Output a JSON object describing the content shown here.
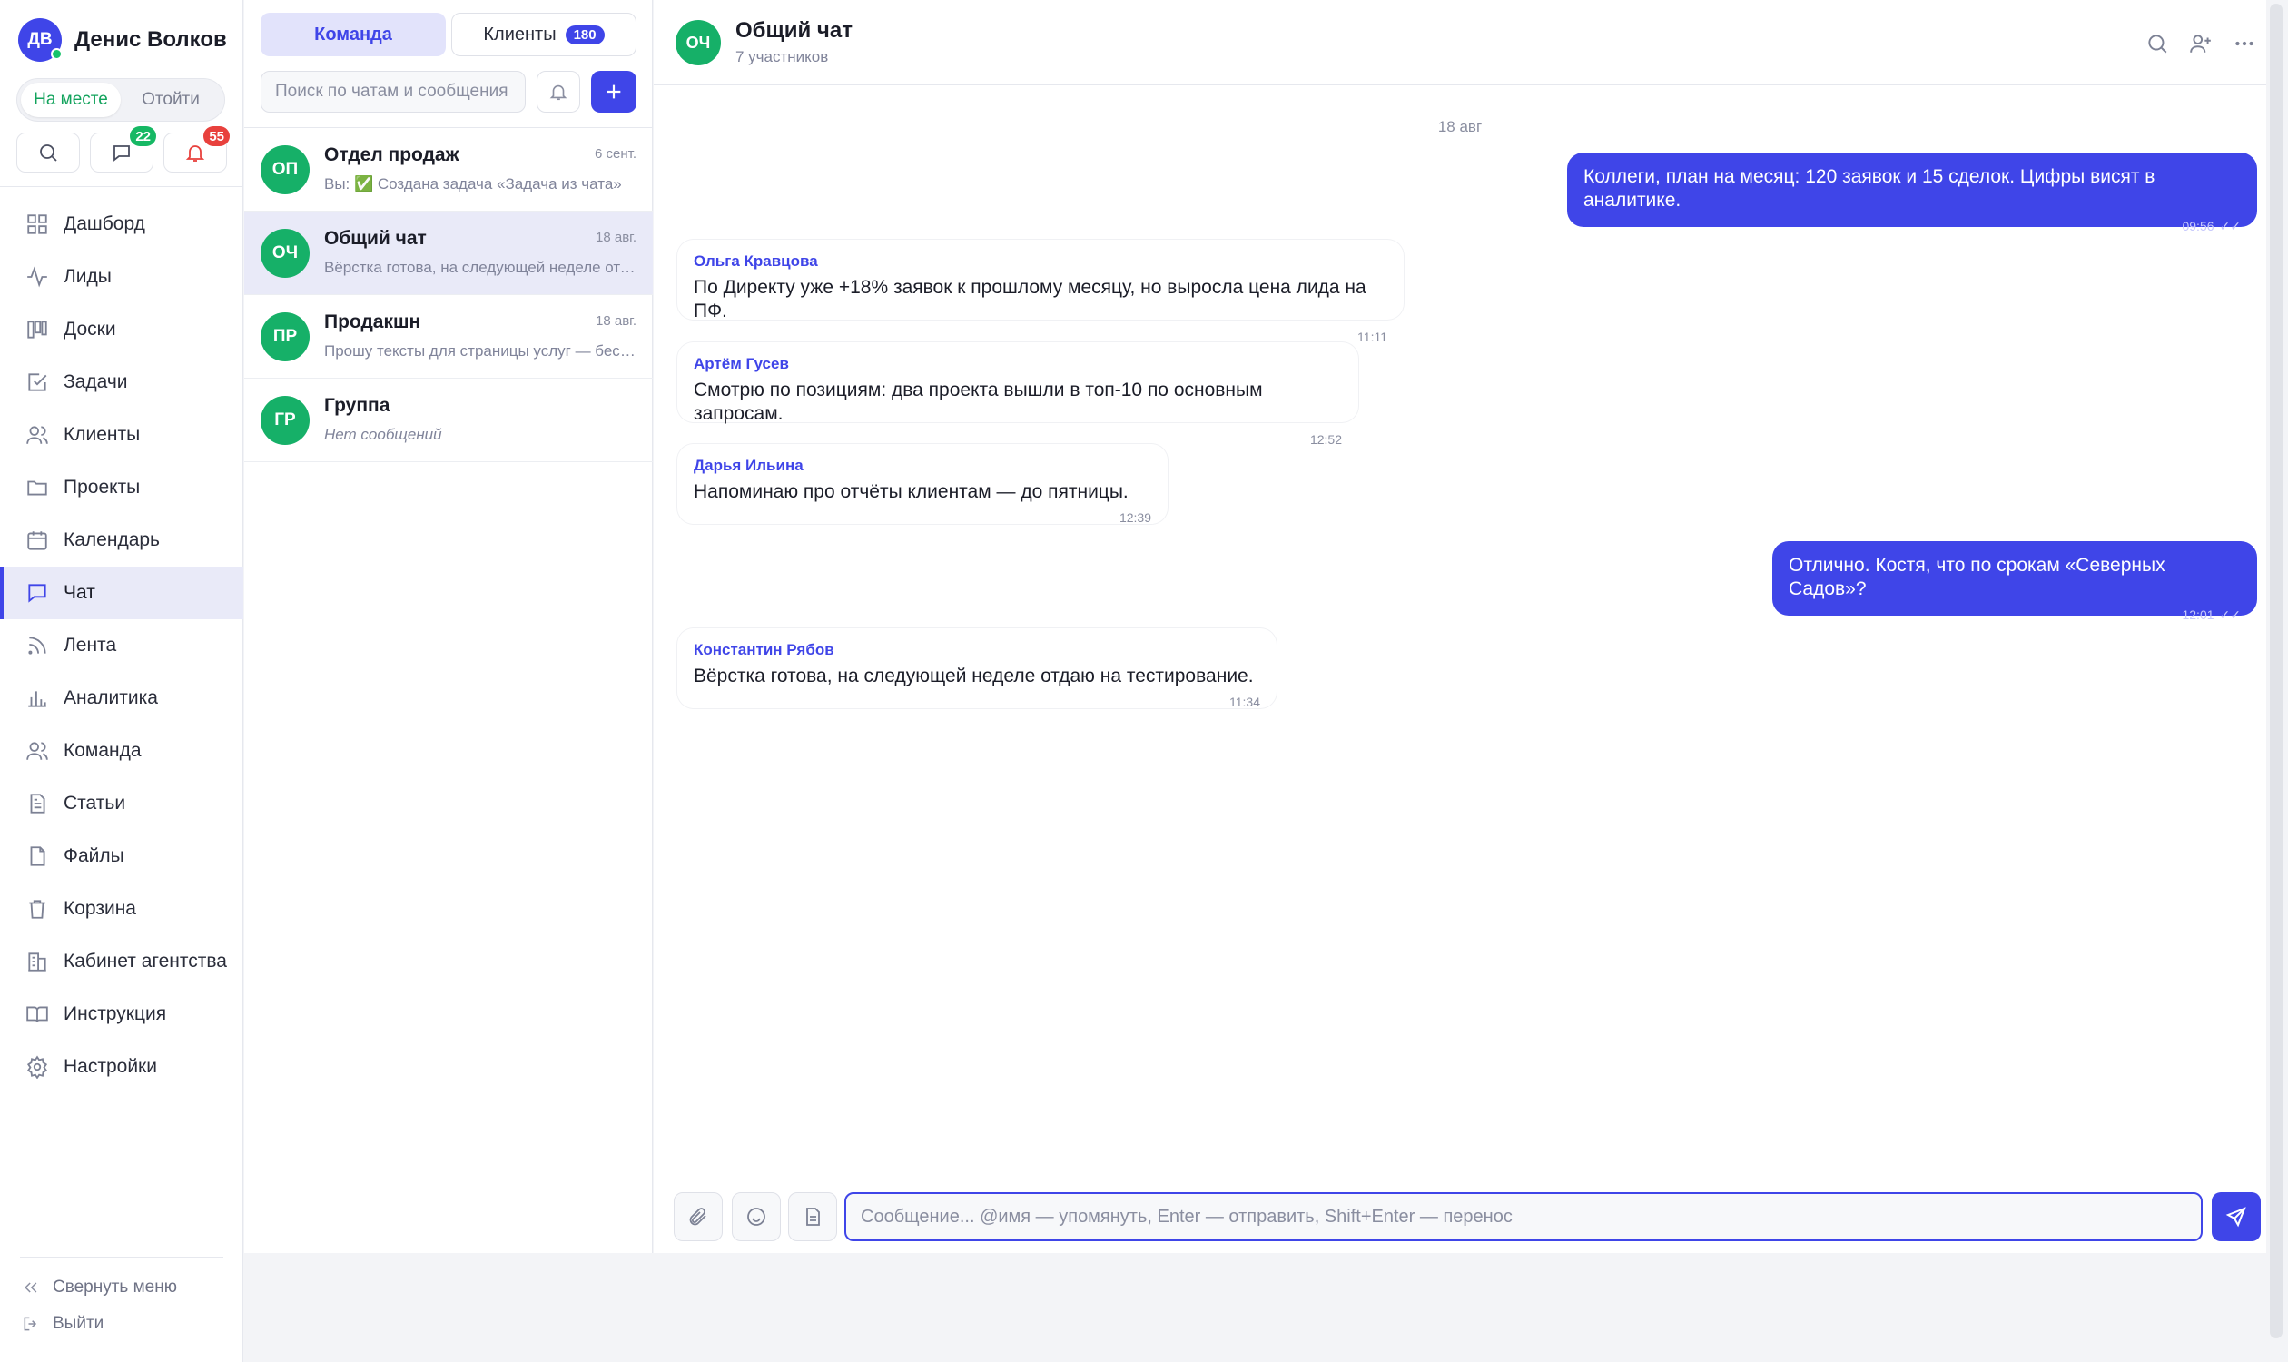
{
  "user": {
    "initials": "ДВ",
    "name": "Денис Волков"
  },
  "presence": {
    "here": "На месте",
    "away": "Отойти"
  },
  "quick": {
    "messages_badge": "22",
    "notifications_badge": "55"
  },
  "nav": {
    "items": [
      {
        "label": "Дашборд",
        "icon": "dashboard-icon"
      },
      {
        "label": "Лиды",
        "icon": "activity-icon"
      },
      {
        "label": "Доски",
        "icon": "kanban-icon"
      },
      {
        "label": "Задачи",
        "icon": "task-icon"
      },
      {
        "label": "Клиенты",
        "icon": "users-icon"
      },
      {
        "label": "Проекты",
        "icon": "folder-icon"
      },
      {
        "label": "Календарь",
        "icon": "calendar-icon"
      },
      {
        "label": "Чат",
        "icon": "chat-icon"
      },
      {
        "label": "Лента",
        "icon": "rss-icon"
      },
      {
        "label": "Аналитика",
        "icon": "bar-chart-icon"
      },
      {
        "label": "Команда",
        "icon": "team-icon"
      },
      {
        "label": "Статьи",
        "icon": "document-icon"
      },
      {
        "label": "Файлы",
        "icon": "file-icon"
      },
      {
        "label": "Корзина",
        "icon": "trash-icon"
      },
      {
        "label": "Кабинет агентства",
        "icon": "building-icon"
      },
      {
        "label": "Инструкция",
        "icon": "book-icon"
      },
      {
        "label": "Настройки",
        "icon": "gear-icon"
      }
    ],
    "collapse": "Свернуть меню",
    "logout": "Выйти"
  },
  "list": {
    "tab_team": "Команда",
    "tab_clients": "Клиенты",
    "clients_count": "180",
    "search_placeholder": "Поиск по чатам и сообщения",
    "chats": [
      {
        "initials": "ОП",
        "name": "Отдел продаж",
        "date": "6 сент.",
        "preview": "Вы: ✅ Создана задача «Задача из чата»"
      },
      {
        "initials": "ОЧ",
        "name": "Общий чат",
        "date": "18 авг.",
        "preview": "Вёрстка готова, на следующей неделе отдаю на тестирование."
      },
      {
        "initials": "ПР",
        "name": "Продакшн",
        "date": "18 авг.",
        "preview": "Прошу тексты для страницы услуг — бесплатно"
      },
      {
        "initials": "ГР",
        "name": "Группа",
        "date": "",
        "preview": "Нет сообщений"
      }
    ]
  },
  "conversation": {
    "initials": "ОЧ",
    "title": "Общий чат",
    "subtitle": "7 участников",
    "day": "18 авг",
    "messages": [
      {
        "out": true,
        "author": "",
        "text": "Коллеги, план на месяц: 120 заявок и 15 сделок. Цифры висят в аналитике.",
        "time": "09:56"
      },
      {
        "out": false,
        "author": "Ольга Кравцова",
        "text": "По Директу уже +18% заявок к прошлому месяцу, но выросла цена лида на ПФ.",
        "time": "11:11"
      },
      {
        "out": false,
        "author": "Артём Гусев",
        "text": "Смотрю по позициям: два проекта вышли в топ-10 по основным запросам.",
        "time": "12:52"
      },
      {
        "out": false,
        "author": "Дарья Ильина",
        "text": "Напоминаю про отчёты клиентам — до пятницы.",
        "time": "12:39"
      },
      {
        "out": true,
        "author": "",
        "text": "Отлично. Костя, что по срокам «Северных Садов»?",
        "time": "12:01"
      },
      {
        "out": false,
        "author": "Константин Рябов",
        "text": "Вёрстка готова, на следующей неделе отдаю на тестирование.",
        "time": "11:34"
      }
    ],
    "input_placeholder": "Сообщение... @имя — упомянуть, Enter — отправить, Shift+Enter — перенос"
  },
  "colors": {
    "accent": "#3f45e8",
    "online": "#16c36a",
    "avatar_green": "#16b068",
    "badge_red": "#e8413d"
  }
}
